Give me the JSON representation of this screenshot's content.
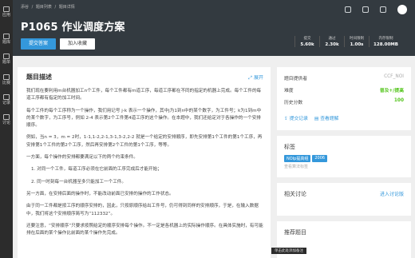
{
  "nav": [
    {
      "label": "应用",
      "icon": "apps-icon"
    },
    {
      "label": "题库",
      "icon": "problem-library-icon"
    },
    {
      "label": "题单",
      "icon": "problem-list-icon"
    },
    {
      "label": "比赛",
      "icon": "contest-icon"
    },
    {
      "label": "记录",
      "icon": "records-icon"
    },
    {
      "label": "讨论",
      "icon": "discussion-icon"
    }
  ],
  "breadcrumb": [
    "添谷",
    "/",
    "题目列表",
    "/",
    "题目详情"
  ],
  "title": "P1065 作业调度方案",
  "buttons": {
    "submit": "提交答案",
    "favorite": "加入收藏"
  },
  "stats": [
    {
      "label": "提交",
      "value": "5.60k"
    },
    {
      "label": "通过",
      "value": "2.30k"
    },
    {
      "label": "时间限制",
      "value": "1.00s"
    },
    {
      "label": "内存限制",
      "value": "128.00MB"
    }
  ],
  "problem": {
    "heading": "题目描述",
    "expand": "展开",
    "paragraphs": [
      "我们现在要利用m台机器加工n个工件，每个工件都有m道工序，每道工序都在不同的指定的机器上完成。每个工件的每道工序都有指定的加工时间。",
      "每个工件的每个工序称为一个操作，我们用记号 j-k 表示一个操作，其中j为1到n中的某个数字，为工件号；k为1到m中的某个数字，为工序号，例如 2-4 表示第2个工件第4道工序的这个操作。在本题中，我们还给定对于各操作的一个安排顺序。",
      "例如，当n = 3，m = 2时，1-1,1-2,2-1,3-1,3-2,2-2 就是一个给定的安排顺序，即先安排第1个工件的第1个工序，再安排第1个工件的第2个工序，然后再安排第2个工件的第1个工序，等等。",
      "一方面，每个操作的安排都要满足以下的两个约束条件。",
      "1. 对同一个工件，每道工序必须在它前面的工序完成后才能开始；",
      "2. 同一时刻每一台机器至多只能加工一个工件。",
      "另一方面，在安排后面的操作时，不能改动前面已安排的操作的工作状态。",
      "由于同一工件都是按工序的顺序安排的，因此，只按原顺序给出工件号，仍可得到同样的安排顺序，于是，在输入数据中，我们将这个安排顺序简写为“112332”。",
      "还要注意，“安排顺序”只要求按照给定的顺序安排每个操作。不一定是各机器上的实际操作顺序。在具体实施时，有可能排在后面的某个操作比前面的某个操作先完成。"
    ]
  },
  "info": {
    "rows": [
      {
        "label": "题目提供者",
        "value": "CCF_NOI",
        "color": "#aaaaaa"
      },
      {
        "label": "难度",
        "value": "普及+/提高",
        "color": "#52c41a"
      },
      {
        "label": "历史分数",
        "value": "100",
        "color": "#52c41a"
      }
    ],
    "submit_record": "提交记录",
    "view_solution": "查看题解"
  },
  "tags": {
    "title": "标签",
    "items": [
      "NOIp提高组",
      "2006"
    ],
    "show_hint": "查看算法标签"
  },
  "discussion": {
    "title": "相关讨论",
    "more": "进入讨论版"
  },
  "recommend": {
    "title": "推荐题目"
  },
  "tooltip": "单击此处添加备注"
}
